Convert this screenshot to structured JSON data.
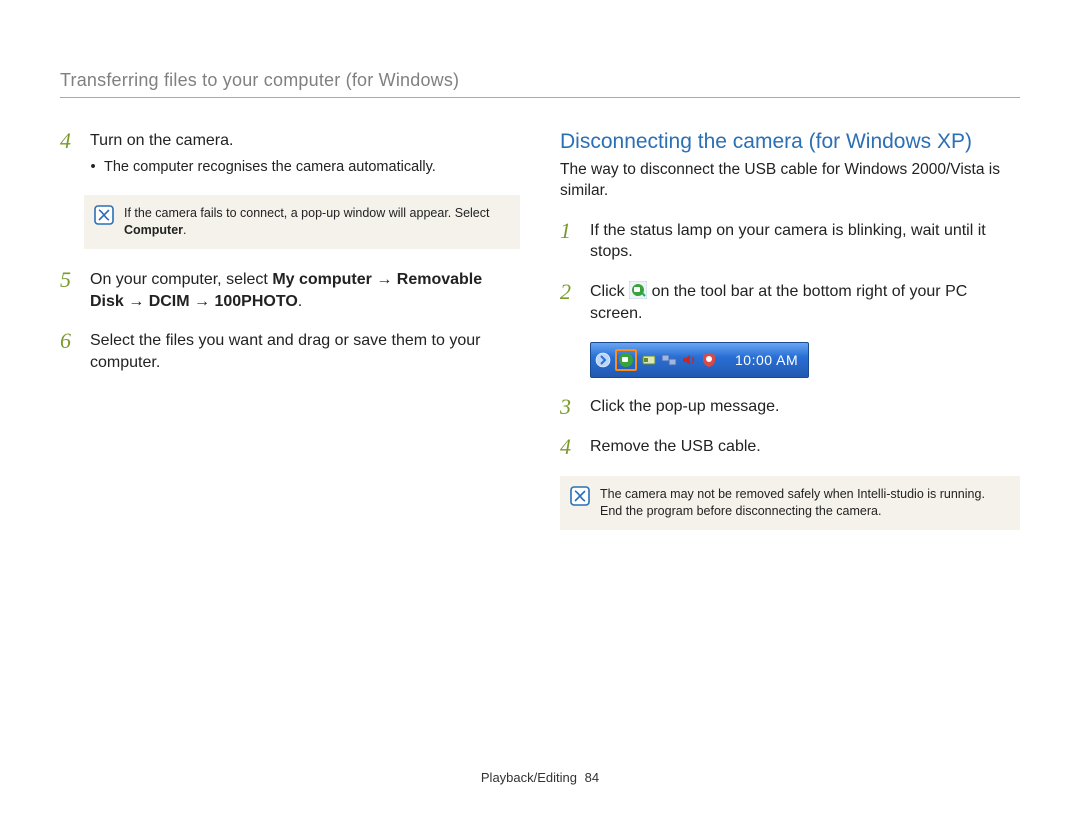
{
  "header": {
    "title": "Transferring files to your computer (for Windows)"
  },
  "left": {
    "step4": {
      "num": "4",
      "text": "Turn on the camera."
    },
    "step4_bullet": "The computer recognises the camera automatically.",
    "note1": {
      "line": "If the camera fails to connect, a pop-up window will appear. Select ",
      "bold": "Computer",
      "tail": "."
    },
    "step5": {
      "num": "5",
      "lead": "On your computer, select ",
      "path": "My computer → Removable Disk → DCIM → 100PHOTO",
      "tail": "."
    },
    "step6": {
      "num": "6",
      "text": "Select the files you want and drag or save them to your computer."
    }
  },
  "right": {
    "heading": "Disconnecting the camera (for Windows XP)",
    "sub": "The way to disconnect the USB cable for Windows 2000/Vista is similar.",
    "step1": {
      "num": "1",
      "text": "If the status lamp on your camera is blinking, wait until it stops."
    },
    "step2": {
      "num": "2",
      "lead": "Click ",
      "tail": " on the tool bar at the bottom right of your PC screen."
    },
    "taskbar": {
      "clock": "10:00 AM"
    },
    "step3": {
      "num": "3",
      "text": "Click the pop-up message."
    },
    "step4": {
      "num": "4",
      "text": "Remove the USB cable."
    },
    "note2": "The camera may not be removed safely when Intelli-studio is running. End the program before disconnecting the camera."
  },
  "footer": {
    "section": "Playback/Editing",
    "page": "84"
  }
}
